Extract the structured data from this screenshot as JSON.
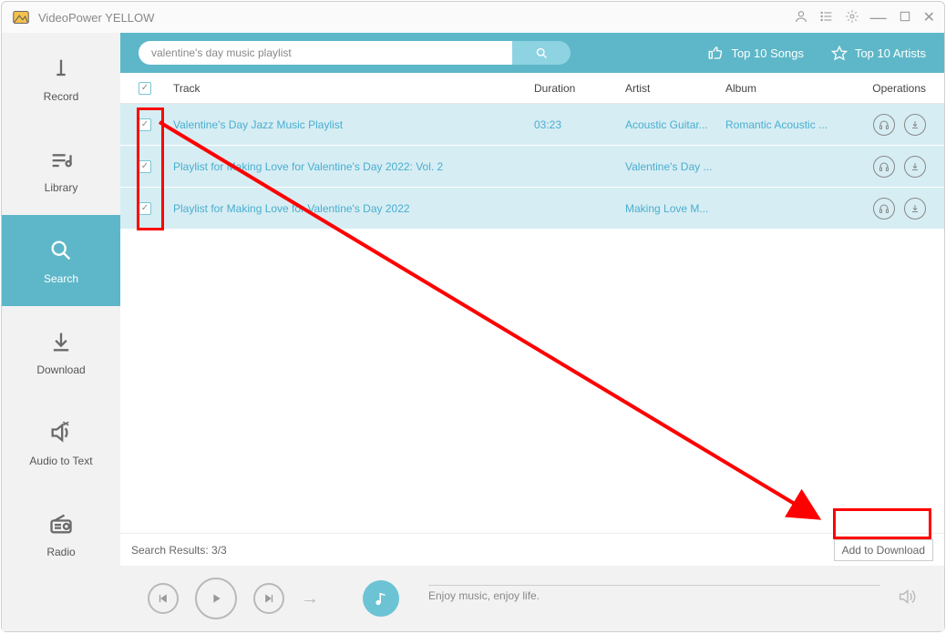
{
  "app": {
    "title": "VideoPower YELLOW"
  },
  "sidebar": {
    "items": [
      {
        "label": "Record"
      },
      {
        "label": "Library"
      },
      {
        "label": "Search"
      },
      {
        "label": "Download"
      },
      {
        "label": "Audio to Text"
      },
      {
        "label": "Radio"
      }
    ]
  },
  "ribbon": {
    "search_value": "valentine's day music playlist",
    "quick_links": {
      "songs": "Top 10 Songs",
      "artists": "Top 10 Artists"
    }
  },
  "columns": {
    "track": "Track",
    "duration": "Duration",
    "artist": "Artist",
    "album": "Album",
    "ops": "Operations"
  },
  "rows": [
    {
      "track": "Valentine's Day Jazz Music Playlist",
      "duration": "03:23",
      "artist": "Acoustic Guitar...",
      "album": "Romantic Acoustic ..."
    },
    {
      "track": "Playlist for Making Love for Valentine's Day 2022: Vol. 2",
      "duration": "",
      "artist": "Valentine's Day ...",
      "album": ""
    },
    {
      "track": "Playlist for Making Love for Valentine's Day 2022",
      "duration": "",
      "artist": "Making Love M...",
      "album": ""
    }
  ],
  "statusbar": {
    "results": "Search Results: 3/3",
    "add_btn": "Add to Download"
  },
  "playbar": {
    "nowplaying": "Enjoy music, enjoy life."
  }
}
